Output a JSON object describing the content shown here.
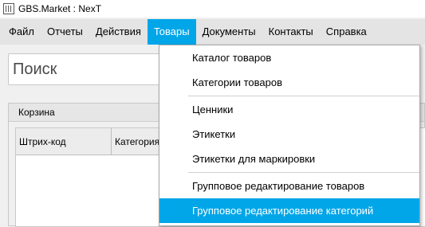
{
  "window": {
    "title": "GBS.Market : NexT"
  },
  "menubar": {
    "items": [
      {
        "label": "Файл"
      },
      {
        "label": "Отчеты"
      },
      {
        "label": "Действия"
      },
      {
        "label": "Товары"
      },
      {
        "label": "Документы"
      },
      {
        "label": "Контакты"
      },
      {
        "label": "Справка"
      }
    ],
    "active_index": 3
  },
  "search": {
    "placeholder": "Поиск",
    "value": ""
  },
  "cart": {
    "title": "Корзина",
    "columns": [
      "Штрих-код",
      "Категория"
    ]
  },
  "dropdown": {
    "groups": [
      [
        "Каталог товаров",
        "Категории товаров"
      ],
      [
        "Ценники",
        "Этикетки",
        "Этикетки для маркировки"
      ],
      [
        "Групповое редактирование товаров",
        "Групповое редактирование категорий"
      ]
    ],
    "highlighted": "Групповое редактирование категорий"
  },
  "colors": {
    "accent": "#00a6e8",
    "menubar_bg": "#e4e4e4",
    "window_bg": "#f0f0f0"
  }
}
